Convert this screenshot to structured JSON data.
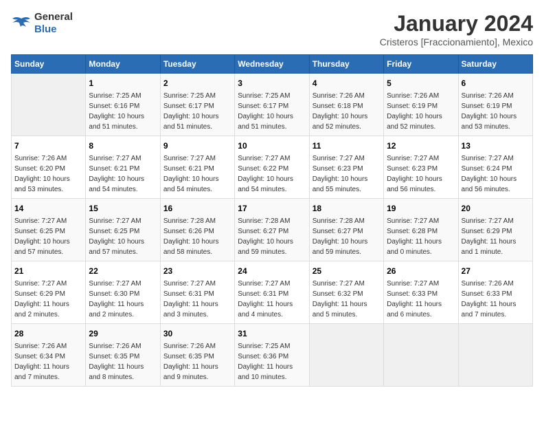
{
  "header": {
    "logo_general": "General",
    "logo_blue": "Blue",
    "month_title": "January 2024",
    "location": "Cristeros [Fraccionamiento], Mexico"
  },
  "days_of_week": [
    "Sunday",
    "Monday",
    "Tuesday",
    "Wednesday",
    "Thursday",
    "Friday",
    "Saturday"
  ],
  "weeks": [
    [
      {
        "day": "",
        "info": ""
      },
      {
        "day": "1",
        "info": "Sunrise: 7:25 AM\nSunset: 6:16 PM\nDaylight: 10 hours\nand 51 minutes."
      },
      {
        "day": "2",
        "info": "Sunrise: 7:25 AM\nSunset: 6:17 PM\nDaylight: 10 hours\nand 51 minutes."
      },
      {
        "day": "3",
        "info": "Sunrise: 7:25 AM\nSunset: 6:17 PM\nDaylight: 10 hours\nand 51 minutes."
      },
      {
        "day": "4",
        "info": "Sunrise: 7:26 AM\nSunset: 6:18 PM\nDaylight: 10 hours\nand 52 minutes."
      },
      {
        "day": "5",
        "info": "Sunrise: 7:26 AM\nSunset: 6:19 PM\nDaylight: 10 hours\nand 52 minutes."
      },
      {
        "day": "6",
        "info": "Sunrise: 7:26 AM\nSunset: 6:19 PM\nDaylight: 10 hours\nand 53 minutes."
      }
    ],
    [
      {
        "day": "7",
        "info": "Sunrise: 7:26 AM\nSunset: 6:20 PM\nDaylight: 10 hours\nand 53 minutes."
      },
      {
        "day": "8",
        "info": "Sunrise: 7:27 AM\nSunset: 6:21 PM\nDaylight: 10 hours\nand 54 minutes."
      },
      {
        "day": "9",
        "info": "Sunrise: 7:27 AM\nSunset: 6:21 PM\nDaylight: 10 hours\nand 54 minutes."
      },
      {
        "day": "10",
        "info": "Sunrise: 7:27 AM\nSunset: 6:22 PM\nDaylight: 10 hours\nand 54 minutes."
      },
      {
        "day": "11",
        "info": "Sunrise: 7:27 AM\nSunset: 6:23 PM\nDaylight: 10 hours\nand 55 minutes."
      },
      {
        "day": "12",
        "info": "Sunrise: 7:27 AM\nSunset: 6:23 PM\nDaylight: 10 hours\nand 56 minutes."
      },
      {
        "day": "13",
        "info": "Sunrise: 7:27 AM\nSunset: 6:24 PM\nDaylight: 10 hours\nand 56 minutes."
      }
    ],
    [
      {
        "day": "14",
        "info": "Sunrise: 7:27 AM\nSunset: 6:25 PM\nDaylight: 10 hours\nand 57 minutes."
      },
      {
        "day": "15",
        "info": "Sunrise: 7:27 AM\nSunset: 6:25 PM\nDaylight: 10 hours\nand 57 minutes."
      },
      {
        "day": "16",
        "info": "Sunrise: 7:28 AM\nSunset: 6:26 PM\nDaylight: 10 hours\nand 58 minutes."
      },
      {
        "day": "17",
        "info": "Sunrise: 7:28 AM\nSunset: 6:27 PM\nDaylight: 10 hours\nand 59 minutes."
      },
      {
        "day": "18",
        "info": "Sunrise: 7:28 AM\nSunset: 6:27 PM\nDaylight: 10 hours\nand 59 minutes."
      },
      {
        "day": "19",
        "info": "Sunrise: 7:27 AM\nSunset: 6:28 PM\nDaylight: 11 hours\nand 0 minutes."
      },
      {
        "day": "20",
        "info": "Sunrise: 7:27 AM\nSunset: 6:29 PM\nDaylight: 11 hours\nand 1 minute."
      }
    ],
    [
      {
        "day": "21",
        "info": "Sunrise: 7:27 AM\nSunset: 6:29 PM\nDaylight: 11 hours\nand 2 minutes."
      },
      {
        "day": "22",
        "info": "Sunrise: 7:27 AM\nSunset: 6:30 PM\nDaylight: 11 hours\nand 2 minutes."
      },
      {
        "day": "23",
        "info": "Sunrise: 7:27 AM\nSunset: 6:31 PM\nDaylight: 11 hours\nand 3 minutes."
      },
      {
        "day": "24",
        "info": "Sunrise: 7:27 AM\nSunset: 6:31 PM\nDaylight: 11 hours\nand 4 minutes."
      },
      {
        "day": "25",
        "info": "Sunrise: 7:27 AM\nSunset: 6:32 PM\nDaylight: 11 hours\nand 5 minutes."
      },
      {
        "day": "26",
        "info": "Sunrise: 7:27 AM\nSunset: 6:33 PM\nDaylight: 11 hours\nand 6 minutes."
      },
      {
        "day": "27",
        "info": "Sunrise: 7:26 AM\nSunset: 6:33 PM\nDaylight: 11 hours\nand 7 minutes."
      }
    ],
    [
      {
        "day": "28",
        "info": "Sunrise: 7:26 AM\nSunset: 6:34 PM\nDaylight: 11 hours\nand 7 minutes."
      },
      {
        "day": "29",
        "info": "Sunrise: 7:26 AM\nSunset: 6:35 PM\nDaylight: 11 hours\nand 8 minutes."
      },
      {
        "day": "30",
        "info": "Sunrise: 7:26 AM\nSunset: 6:35 PM\nDaylight: 11 hours\nand 9 minutes."
      },
      {
        "day": "31",
        "info": "Sunrise: 7:25 AM\nSunset: 6:36 PM\nDaylight: 11 hours\nand 10 minutes."
      },
      {
        "day": "",
        "info": ""
      },
      {
        "day": "",
        "info": ""
      },
      {
        "day": "",
        "info": ""
      }
    ]
  ]
}
